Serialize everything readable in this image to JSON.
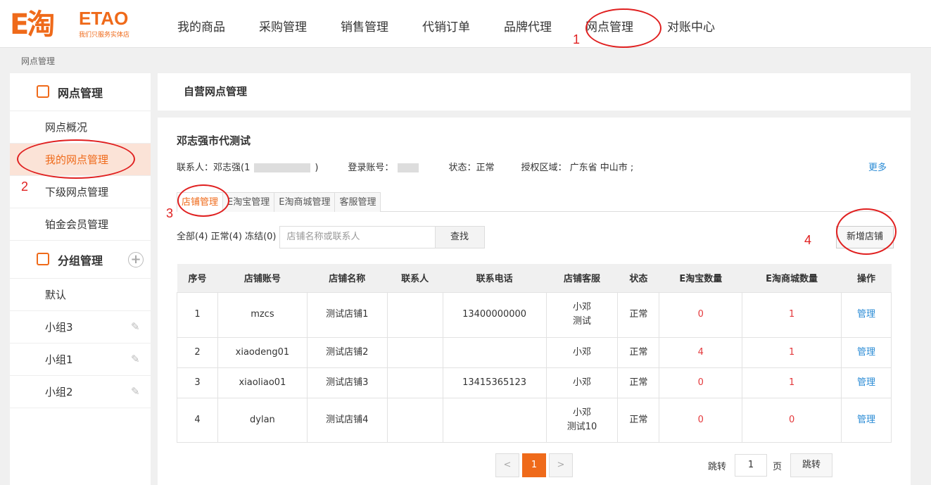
{
  "logo": {
    "mark": "E淘",
    "brand": "ETAO",
    "slogan": "我们只服务实体店"
  },
  "nav": [
    "我的商品",
    "采购管理",
    "销售管理",
    "代销订单",
    "品牌代理",
    "网点管理",
    "对账中心"
  ],
  "breadcrumb": "网点管理",
  "sidebar": {
    "section1": {
      "title": "网点管理",
      "items": [
        "网点概况",
        "我的网点管理",
        "下级网点管理",
        "铂金会员管理"
      ]
    },
    "section2": {
      "title": "分组管理",
      "items": [
        "默认",
        "小组3",
        "小组1",
        "小组2"
      ]
    }
  },
  "panel_title": "自营网点管理",
  "proxy": {
    "name": "邓志强市代测试",
    "contact_label": "联系人：邓志强(1",
    "contact_end": ")",
    "account_label": "登录账号：",
    "status": "状态：正常",
    "region": "授权区域： 广东省 中山市 ;",
    "more": "更多"
  },
  "tabs": [
    "店铺管理",
    "E淘宝管理",
    "E淘商城管理",
    "客服管理"
  ],
  "filter": {
    "summary": "全部(4) 正常(4) 冻结(0)",
    "placeholder": "店铺名称或联系人",
    "search": "查找"
  },
  "add_button": "新增店铺",
  "table": {
    "headers": [
      "序号",
      "店铺账号",
      "店铺名称",
      "联系人",
      "联系电话",
      "店铺客服",
      "状态",
      "E淘宝数量",
      "E淘商城数量",
      "操作"
    ],
    "rows": [
      {
        "no": "1",
        "account": "mzcs",
        "name": "测试店铺1",
        "contact": "",
        "phone": "13400000000",
        "service1": "小邓",
        "service2": "测试",
        "status": "正常",
        "etb": "0",
        "etmall": "1",
        "op": "管理"
      },
      {
        "no": "2",
        "account": "xiaodeng01",
        "name": "测试店铺2",
        "contact": "",
        "phone": "",
        "service1": "小邓",
        "service2": "",
        "status": "正常",
        "etb": "4",
        "etmall": "1",
        "op": "管理"
      },
      {
        "no": "3",
        "account": "xiaoliao01",
        "name": "测试店铺3",
        "contact": "",
        "phone": "13415365123",
        "service1": "小邓",
        "service2": "",
        "status": "正常",
        "etb": "0",
        "etmall": "1",
        "op": "管理"
      },
      {
        "no": "4",
        "account": "dylan",
        "name": "测试店铺4",
        "contact": "",
        "phone": "",
        "service1": "小邓",
        "service2": "测试10",
        "status": "正常",
        "etb": "0",
        "etmall": "0",
        "op": "管理"
      }
    ]
  },
  "pagination": {
    "prev": "<",
    "current": "1",
    "next": ">",
    "jump_label": "跳转",
    "page_value": "1",
    "page_unit": "页",
    "jump_button": "跳转"
  },
  "annotations": [
    "1",
    "2",
    "3",
    "4"
  ],
  "colors": {
    "accent": "#ef6a1a",
    "link": "#2a8bd5",
    "red": "#e4393c",
    "annotation": "#e02020"
  }
}
